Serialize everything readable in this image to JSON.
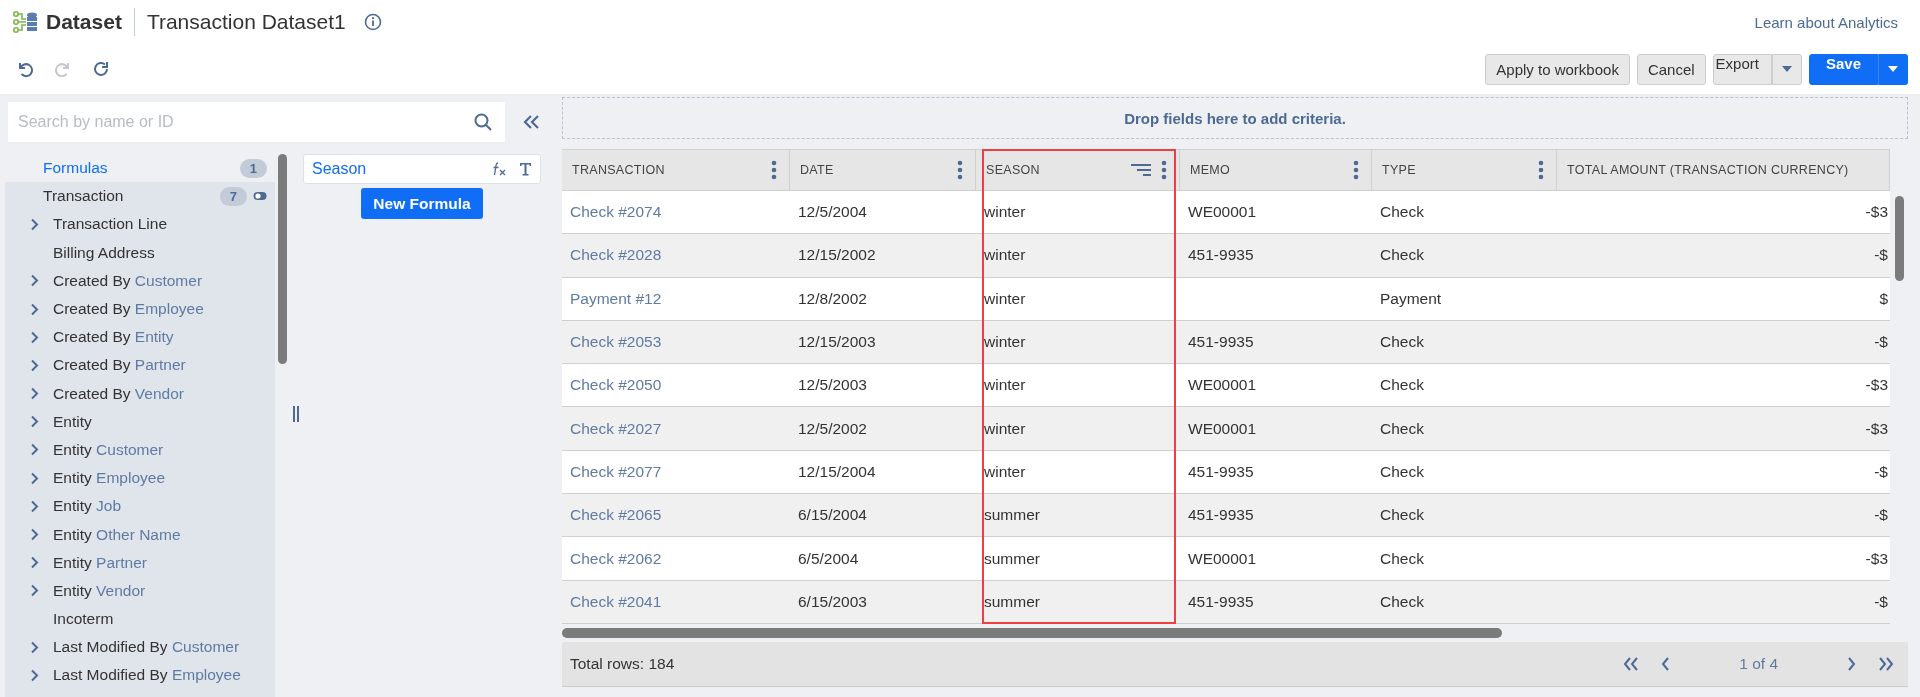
{
  "header": {
    "app_title": "Dataset",
    "dataset_name": "Transaction Dataset1",
    "help_link": "Learn about Analytics"
  },
  "history_buttons": [
    {
      "kind": "undo",
      "disabled": false
    },
    {
      "kind": "redo",
      "disabled": true
    },
    {
      "kind": "refresh",
      "disabled": false
    }
  ],
  "actions": [
    {
      "label": "Apply to workbook",
      "kind": "plain"
    },
    {
      "label": "Cancel",
      "kind": "plain"
    },
    {
      "label": "Export",
      "kind": "split"
    },
    {
      "label": "Save",
      "kind": "primary_split"
    }
  ],
  "field_search": {
    "placeholder": "Search by name or ID"
  },
  "field_tree": [
    {
      "kind": "formulas",
      "label": "Formulas",
      "count": "1"
    },
    {
      "kind": "root",
      "label": "Transaction",
      "count": "7"
    },
    {
      "kind": "join",
      "label": "Transaction Line",
      "expanded": false
    },
    {
      "kind": "field",
      "label": "Billing Address"
    },
    {
      "kind": "join",
      "label": "Created By",
      "target": "Customer",
      "expanded": false
    },
    {
      "kind": "join",
      "label": "Created By",
      "target": "Employee",
      "expanded": false
    },
    {
      "kind": "join",
      "label": "Created By",
      "target": "Entity",
      "expanded": false
    },
    {
      "kind": "join",
      "label": "Created By",
      "target": "Partner",
      "expanded": false
    },
    {
      "kind": "join",
      "label": "Created By",
      "target": "Vendor",
      "expanded": false
    },
    {
      "kind": "join",
      "label": "Entity",
      "expanded": false
    },
    {
      "kind": "join",
      "label": "Entity",
      "target": "Customer",
      "expanded": false
    },
    {
      "kind": "join",
      "label": "Entity",
      "target": "Employee",
      "expanded": false
    },
    {
      "kind": "join",
      "label": "Entity",
      "target": "Job",
      "expanded": false
    },
    {
      "kind": "join",
      "label": "Entity",
      "target": "Other Name",
      "expanded": false
    },
    {
      "kind": "join",
      "label": "Entity",
      "target": "Partner",
      "expanded": false
    },
    {
      "kind": "join",
      "label": "Entity",
      "target": "Vendor",
      "expanded": false
    },
    {
      "kind": "field",
      "label": "Incoterm"
    },
    {
      "kind": "join",
      "label": "Last Modified By",
      "target": "Customer",
      "expanded": false
    },
    {
      "kind": "join",
      "label": "Last Modified By",
      "target": "Employee",
      "expanded": false
    }
  ],
  "formulas": [
    {
      "name": "Season"
    }
  ],
  "new_formula_button": "New Formula",
  "criteria_zone": {
    "placeholder": "Drop fields here to add criteria."
  },
  "table": {
    "columns": [
      {
        "label": "TRANSACTION",
        "kind": "link",
        "menu": true,
        "sorted": false,
        "highlighted": false
      },
      {
        "label": "DATE",
        "kind": "text",
        "menu": true,
        "sorted": false,
        "highlighted": false
      },
      {
        "label": "SEASON",
        "kind": "text",
        "menu": true,
        "sorted": true,
        "highlighted": true
      },
      {
        "label": "MEMO",
        "kind": "text",
        "menu": true,
        "sorted": false,
        "highlighted": false
      },
      {
        "label": "TYPE",
        "kind": "text",
        "menu": true,
        "sorted": false,
        "highlighted": false
      },
      {
        "label": "TOTAL AMOUNT (TRANSACTION CURRENCY)",
        "kind": "amount",
        "menu": false,
        "sorted": false,
        "highlighted": false
      }
    ],
    "rows": [
      [
        "Check #2074",
        "12/5/2004",
        "winter",
        "WE00001",
        "Check",
        "-$3"
      ],
      [
        "Check #2028",
        "12/15/2002",
        "winter",
        "451-9935",
        "Check",
        "-$"
      ],
      [
        "Payment #12",
        "12/8/2002",
        "winter",
        "",
        "Payment",
        "$"
      ],
      [
        "Check #2053",
        "12/15/2003",
        "winter",
        "451-9935",
        "Check",
        "-$"
      ],
      [
        "Check #2050",
        "12/5/2003",
        "winter",
        "WE00001",
        "Check",
        "-$3"
      ],
      [
        "Check #2027",
        "12/5/2002",
        "winter",
        "WE00001",
        "Check",
        "-$3"
      ],
      [
        "Check #2077",
        "12/15/2004",
        "winter",
        "451-9935",
        "Check",
        "-$"
      ],
      [
        "Check #2065",
        "6/15/2004",
        "summer",
        "451-9935",
        "Check",
        "-$"
      ],
      [
        "Check #2062",
        "6/5/2004",
        "summer",
        "WE00001",
        "Check",
        "-$3"
      ],
      [
        "Check #2041",
        "6/15/2003",
        "summer",
        "451-9935",
        "Check",
        "-$"
      ]
    ]
  },
  "footer": {
    "total_rows": "Total rows: 184",
    "page": "1 of 4"
  }
}
